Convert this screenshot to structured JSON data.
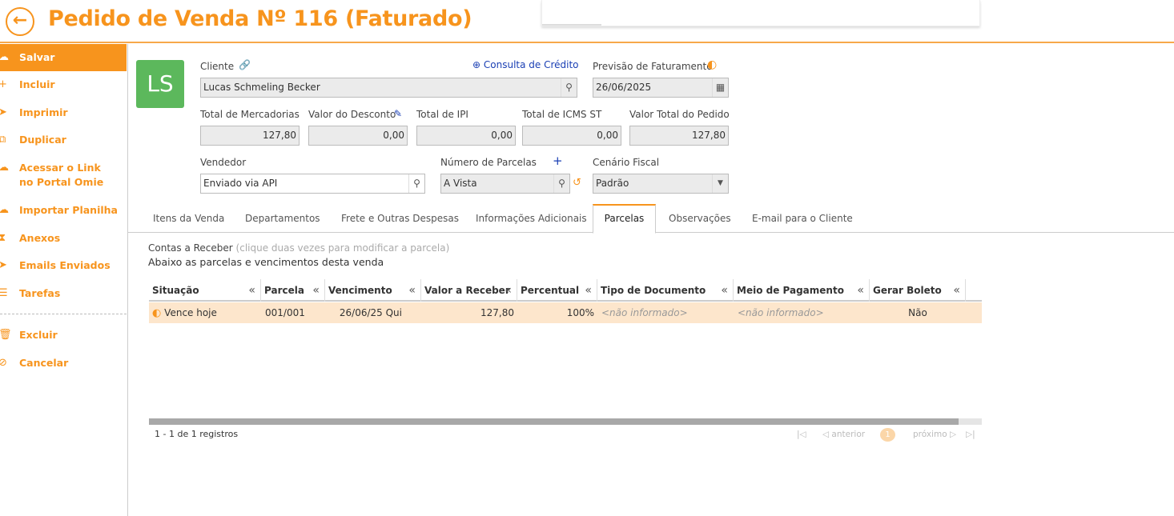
{
  "header": {
    "back_icon": "arrow-left-icon",
    "title": "Pedido de Venda Nº 116 (Faturado)"
  },
  "sidebar": {
    "items": [
      {
        "label": "Salvar",
        "icon": "cloud-icon",
        "active": true
      },
      {
        "label": "Incluir",
        "icon": "plus-icon"
      },
      {
        "label": "Imprimir",
        "icon": "send-icon"
      },
      {
        "label": "Duplicar",
        "icon": "duplicate-icon"
      },
      {
        "label": "Acessar o Link",
        "label2": "no Portal Omie",
        "icon": "cloud-link-icon"
      },
      {
        "label": "Importar Planilha",
        "icon": "cloud-upload-icon"
      },
      {
        "label": "Anexos",
        "icon": "paperclip-icon"
      },
      {
        "label": "Emails Enviados",
        "icon": "send-icon"
      },
      {
        "label": "Tarefas",
        "icon": "list-icon"
      },
      {
        "label": "Excluir",
        "icon": "trash-icon"
      },
      {
        "label": "Cancelar",
        "icon": "cancel-icon"
      }
    ]
  },
  "avatar": {
    "initials": "LS",
    "color": "#5cb85c"
  },
  "form": {
    "cliente": {
      "label": "Cliente",
      "value": "Lucas Schmeling Becker"
    },
    "consulta_credito": "Consulta de Crédito",
    "previsao": {
      "label": "Previsão de Faturamento",
      "value": "26/06/2025"
    },
    "total_mercadorias": {
      "label": "Total de Mercadorias",
      "value": "127,80"
    },
    "valor_desconto": {
      "label": "Valor do Desconto",
      "value": "0,00"
    },
    "total_ipi": {
      "label": "Total de IPI",
      "value": "0,00"
    },
    "total_icms_st": {
      "label": "Total de ICMS ST",
      "value": "0,00"
    },
    "valor_total": {
      "label": "Valor Total do Pedido",
      "value": "127,80"
    },
    "vendedor": {
      "label": "Vendedor",
      "value": "Enviado via API"
    },
    "num_parcelas": {
      "label": "Número de Parcelas",
      "value": "A Vista"
    },
    "cenario_fiscal": {
      "label": "Cenário Fiscal",
      "value": "Padrão"
    }
  },
  "tabs": [
    {
      "label": "Itens da Venda"
    },
    {
      "label": "Departamentos"
    },
    {
      "label": "Frete e Outras Despesas"
    },
    {
      "label": "Informações Adicionais"
    },
    {
      "label": "Parcelas",
      "active": true
    },
    {
      "label": "Observações"
    },
    {
      "label": "E-mail para o Cliente"
    }
  ],
  "parcelas": {
    "section_title": "Contas a Receber",
    "section_hint": "(clique duas vezes para modificar a parcela)",
    "subtitle": "Abaixo as parcelas e vencimentos desta venda",
    "columns": [
      "Situação",
      "Parcela",
      "Vencimento",
      "Valor a Receber",
      "Percentual",
      "Tipo de Documento",
      "Meio de Pagamento",
      "Gerar Boleto"
    ],
    "rows": [
      {
        "situacao": "Vence hoje",
        "parcela": "001/001",
        "vencimento": "26/06/25 Qui",
        "valor": "127,80",
        "percentual": "100%",
        "tipo_documento": "<não informado>",
        "meio_pagamento": "<não informado>",
        "gerar_boleto": "Não"
      }
    ],
    "record_count": "1 - 1 de 1 registros",
    "pager": {
      "prev": "anterior",
      "next": "próximo",
      "page": "1"
    }
  },
  "colors": {
    "accent": "#f7941d",
    "row_highlight": "#fde6cc",
    "link": "#1a3fb4"
  }
}
